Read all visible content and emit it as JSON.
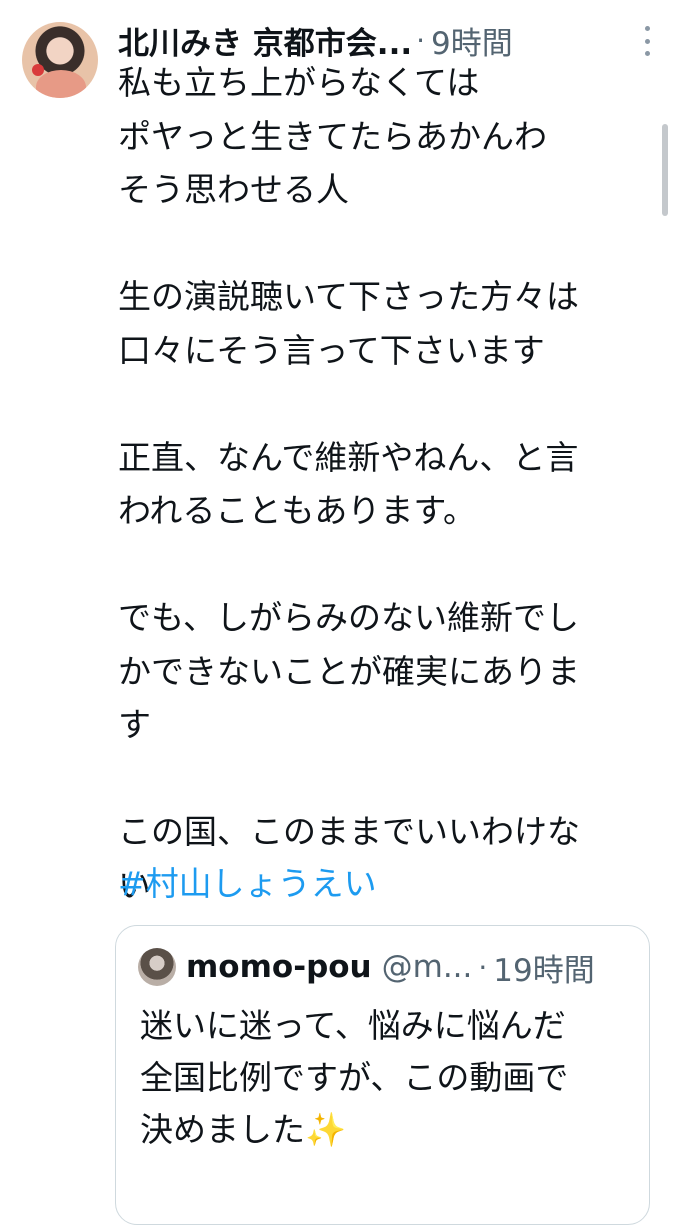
{
  "tweet": {
    "author_name": "北川みき 京都市会...",
    "separator": "·",
    "time": "9時間",
    "body": "私も立ち上がらなくては\nポヤっと生きてたらあかんわ\nそう思わせる人\n\n生の演説聴いて下さった方々は\n口々にそう言って下さいます\n\n正直、なんで維新やねん、と言\nわれることもあります。\n\nでも、しがらみのない維新でし\nかできないことが確実にありま\nす\n\nこの国、このままでいいわけな\nい",
    "hashtag": "#村山しょうえい"
  },
  "quote": {
    "author_name": "momo-pou",
    "handle": "@m...",
    "separator": "·",
    "time": "19時間",
    "body": "迷いに迷って、悩みに悩んだ\n全国比例ですが、この動画で\n決めました",
    "emoji": "✨"
  }
}
